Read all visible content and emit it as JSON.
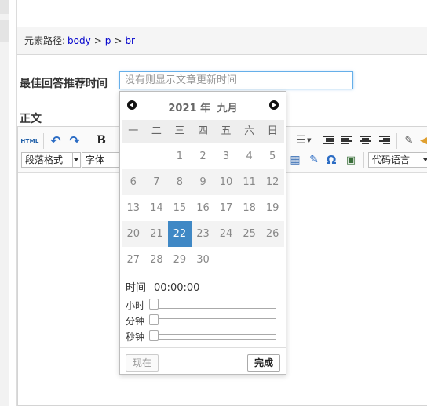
{
  "path_bar": {
    "label": "元素路径:",
    "items": [
      "body",
      "p",
      "br"
    ],
    "separator": ">"
  },
  "field": {
    "label": "最佳回答推荐时间",
    "placeholder": "没有则显示文章更新时间"
  },
  "body_label": "正文",
  "toolbar": {
    "html_label": "HTML",
    "bold_label": "B",
    "paragraph_format": "段落格式",
    "font": "字体",
    "code_language": "代码语言",
    "omega_label": "Ω",
    "icons": [
      "undo-icon",
      "redo-icon",
      "bold-icon",
      "list-icon",
      "indent-icon",
      "align-left-icon",
      "align-center-icon",
      "align-right-icon",
      "eraser-icon",
      "table-icon",
      "attachment-icon",
      "special-char-icon",
      "image-icon"
    ]
  },
  "picker": {
    "year": "2021 年",
    "month": "九月",
    "weekdays": [
      "一",
      "二",
      "三",
      "四",
      "五",
      "六",
      "日"
    ],
    "weeks": [
      [
        "",
        "",
        "1",
        "2",
        "3",
        "4",
        "5"
      ],
      [
        "6",
        "7",
        "8",
        "9",
        "10",
        "11",
        "12"
      ],
      [
        "13",
        "14",
        "15",
        "16",
        "17",
        "18",
        "19"
      ],
      [
        "20",
        "21",
        "22",
        "23",
        "24",
        "25",
        "26"
      ],
      [
        "27",
        "28",
        "29",
        "30",
        "",
        "",
        ""
      ]
    ],
    "selected_day": "22",
    "time_label": "时间",
    "time_value": "00:00:00",
    "hour_label": "小时",
    "minute_label": "分钟",
    "second_label": "秒钟",
    "hour_value": 0,
    "minute_value": 0,
    "second_value": 0,
    "now_button": "现在",
    "done_button": "完成",
    "selected_color": "#3f88c5"
  }
}
